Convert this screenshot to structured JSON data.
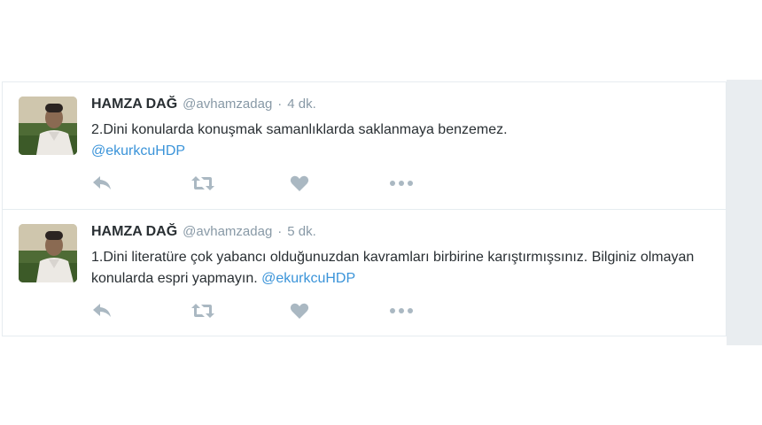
{
  "tweets": [
    {
      "fullname": "HAMZA DAĞ",
      "username": "@avhamzadag",
      "separator": "·",
      "time": "4 dk.",
      "text": "2.Dini konularda konuşmak samanlıklarda saklanmaya benzemez.",
      "mention": "@ekurkcuHDP"
    },
    {
      "fullname": "HAMZA DAĞ",
      "username": "@avhamzadag",
      "separator": "·",
      "time": "5 dk.",
      "text": "1.Dini literatüre çok yabancı olduğunuzdan kavramları birbirine karıştırmışsınız. Bilginiz olmayan konularda espri yapmayın.",
      "mention": "@ekurkcuHDP"
    }
  ],
  "icons": {
    "reply": "reply-icon",
    "retweet": "retweet-icon",
    "like": "heart-icon",
    "more": "more-icon"
  },
  "colors": {
    "name": "#292f33",
    "meta": "#8899a6",
    "mention": "#3b94d9",
    "icon": "#aab8c2"
  }
}
